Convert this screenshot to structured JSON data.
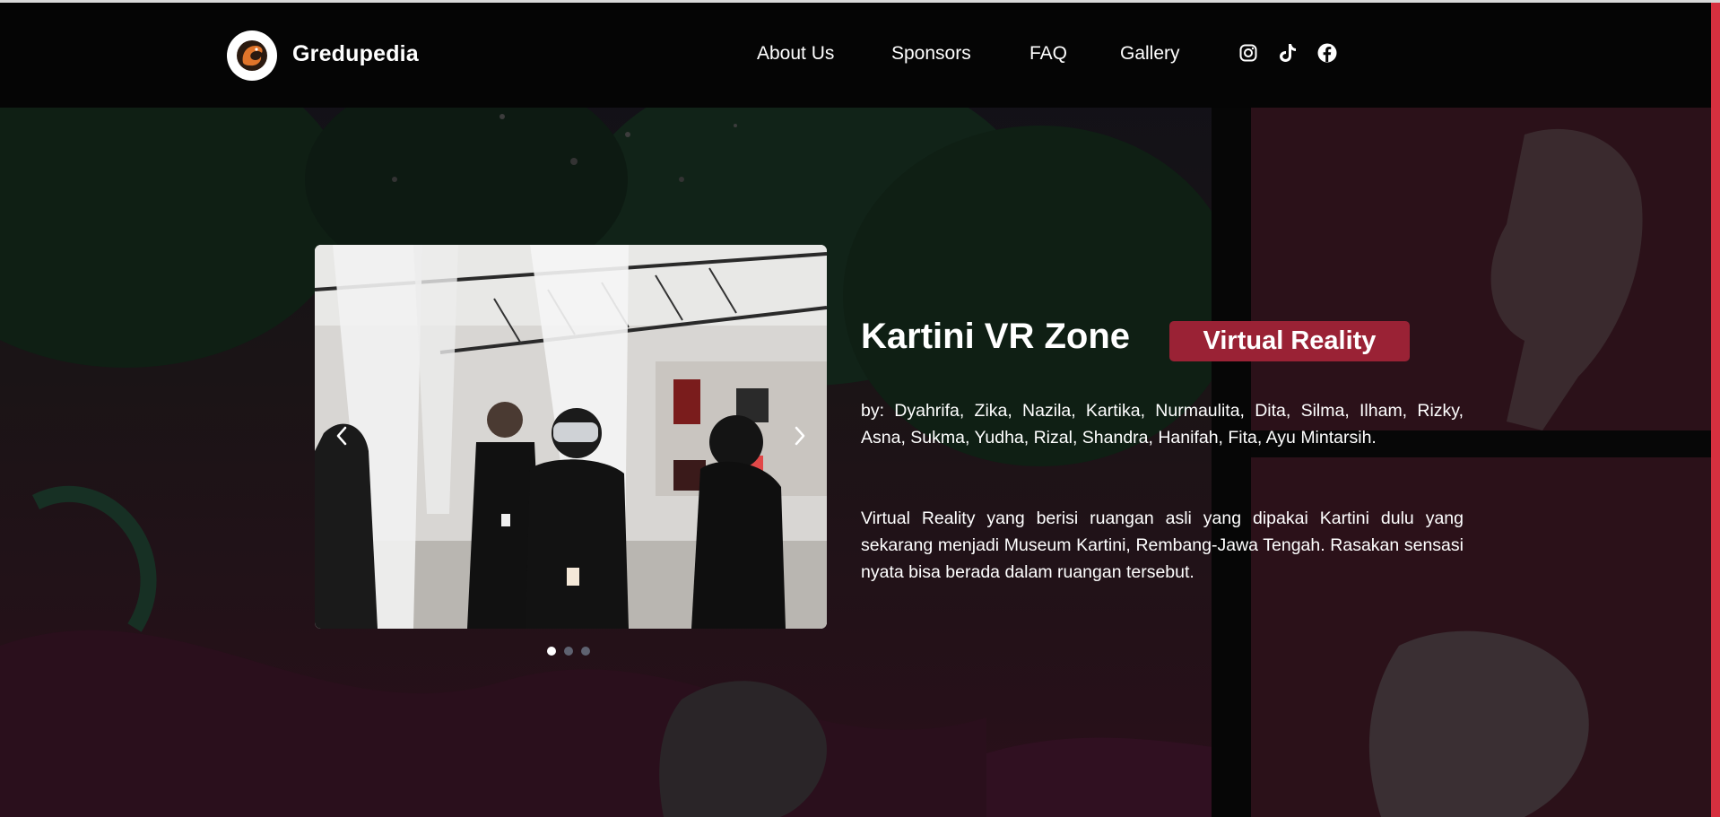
{
  "header": {
    "brand": "Gredupedia",
    "logo_icon": "dragon-logo-icon",
    "nav": [
      "About Us",
      "Sponsors",
      "FAQ",
      "Gallery"
    ],
    "social_icons": [
      "instagram-icon",
      "tiktok-icon",
      "facebook-icon"
    ]
  },
  "slider": {
    "prev_icon": "chevron-left-icon",
    "next_icon": "chevron-right-icon",
    "total_slides": 3,
    "active_slide": 1
  },
  "project": {
    "title": "Kartini VR Zone",
    "badge": "Virtual Reality",
    "authors": "by: Dyahrifa, Zika, Nazila, Kartika, Nurmaulita, Dita, Silma, Ilham, Rizky, Asna, Sukma, Yudha, Rizal, Shandra, Hanifah, Fita, Ayu Mintarsih.",
    "description": "Virtual Reality yang berisi ruangan asli yang dipakai Kartini dulu yang sekarang menjadi Museum Kartini, Rembang-Jawa Tengah. Rasakan sensasi nyata bisa berada dalam ruangan tersebut."
  },
  "colors": {
    "badge": "#9a2235",
    "header_bg": "#050505",
    "accent_edge": "#d6303f"
  }
}
